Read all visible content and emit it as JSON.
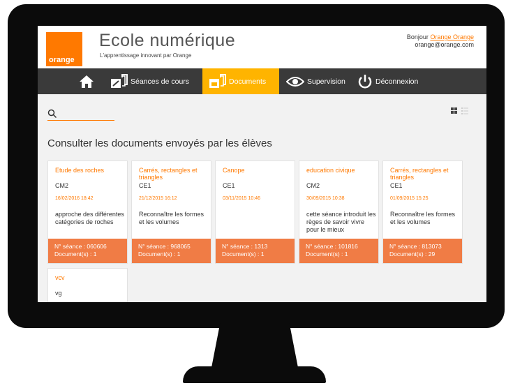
{
  "header": {
    "logo_text": "orange",
    "title": "Ecole numérique",
    "subtitle": "L'apprentissage innovant par Orange",
    "greeting": "Bonjour",
    "user_name": "Orange Orange",
    "email": "orange@orange.com"
  },
  "nav": {
    "home_icon": "home-icon",
    "seances": "Séances de cours",
    "documents": "Documents",
    "supervision": "Supervision",
    "deconnexion": "Déconnexion"
  },
  "search": {
    "value": "",
    "placeholder": ""
  },
  "main": {
    "section_title": "Consulter les documents envoyés par les élèves"
  },
  "colors": {
    "orange": "#ff7900",
    "active_nav": "#ffb400",
    "card_footer": "#f07c45",
    "nav_bg": "#3a3a3a"
  },
  "cards": [
    {
      "title": "Etude des roches",
      "level": "CM2",
      "date": "16/02/2016 18:42",
      "description": "approche des différentes catégories de roches",
      "seance": "N° séance : 060606",
      "documents": "Document(s) : 1"
    },
    {
      "title": "Carrés, rectangles et triangles",
      "level": "CE1",
      "date": "21/12/2015 16:12",
      "description": "Reconnaître les formes et les volumes",
      "seance": "N° séance : 968065",
      "documents": "Document(s) : 1"
    },
    {
      "title": "Canope",
      "level": "CE1",
      "date": "03/11/2015 10:46",
      "description": "",
      "seance": "N° séance : 1313",
      "documents": "Document(s) : 1"
    },
    {
      "title": "education civique",
      "level": "CM2",
      "date": "30/09/2015 10:38",
      "description": "cette séance introduit les règes de savoir vivre pour le mieux",
      "seance": "N° séance : 101816",
      "documents": "Document(s) : 1"
    },
    {
      "title": "Carrés, rectangles et triangles",
      "level": "CE1",
      "date": "01/09/2015 15:25",
      "description": "Reconnaître les formes et les volumes",
      "seance": "N° séance : 813073",
      "documents": "Document(s) : 29"
    },
    {
      "title": "vcv",
      "level": "vg"
    }
  ]
}
